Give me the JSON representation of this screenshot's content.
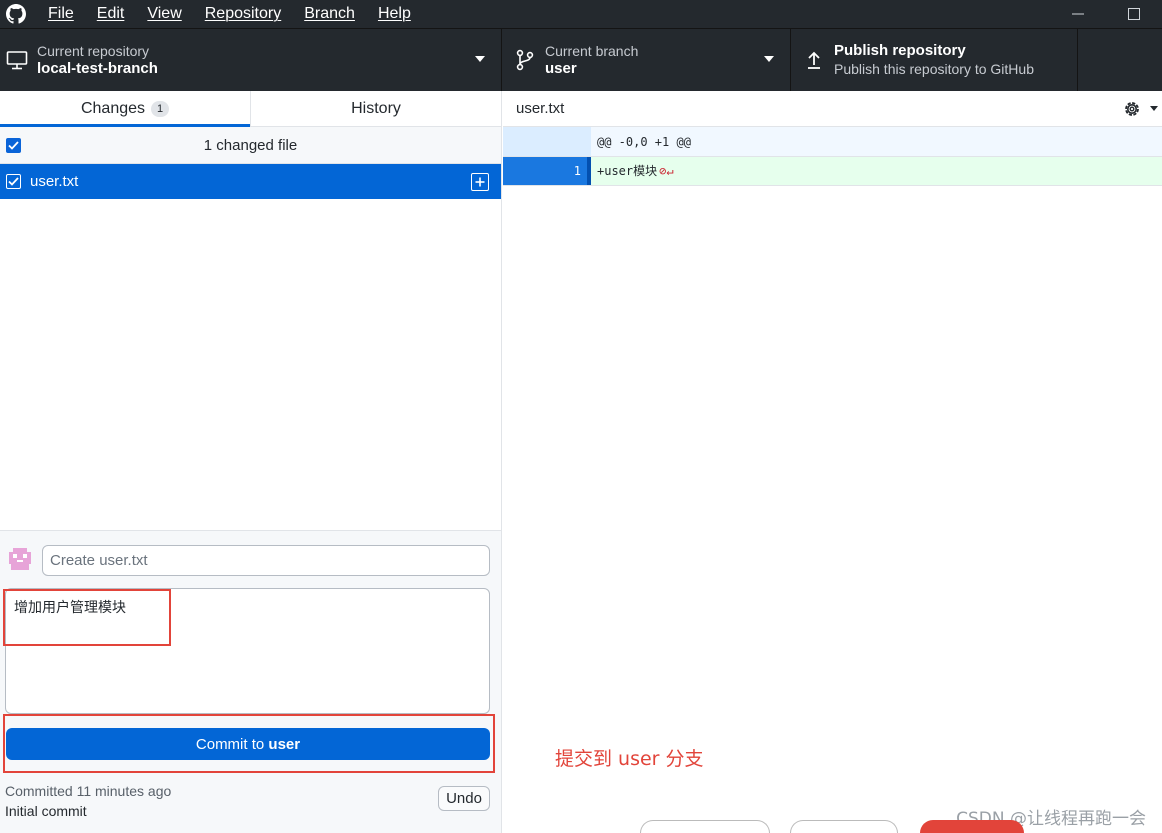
{
  "menu": {
    "items": [
      "File",
      "Edit",
      "View",
      "Repository",
      "Branch",
      "Help"
    ]
  },
  "toolbar": {
    "repo_label": "Current repository",
    "repo_value": "local-test-branch",
    "branch_label": "Current branch",
    "branch_value": "user",
    "publish_title": "Publish repository",
    "publish_subtitle": "Publish this repository to GitHub"
  },
  "tabs": {
    "changes_label": "Changes",
    "changes_count": "1",
    "history_label": "History"
  },
  "changes": {
    "header": "1 changed file",
    "files": [
      {
        "name": "user.txt",
        "status": "added"
      }
    ]
  },
  "commit": {
    "summary_placeholder": "Create user.txt",
    "description": "增加用户管理模块",
    "button_prefix": "Commit to ",
    "button_branch": "user",
    "last_commit_time": "Committed 11 minutes ago",
    "last_commit_message": "Initial commit",
    "undo_label": "Undo"
  },
  "diff": {
    "file": "user.txt",
    "hunk_header": "@@ -0,0 +1 @@",
    "lines": [
      {
        "new_line": "1",
        "text": "+user模块"
      }
    ]
  },
  "annotation": "提交到 user 分支",
  "watermark": "CSDN @让线程再跑一会",
  "colors": {
    "accent": "#0366d6",
    "annotation_red": "#e2443a",
    "titlebar": "#24292e",
    "added_bg": "#e6ffed"
  },
  "icons": {
    "app": "github-logo-icon",
    "repo": "computer-icon",
    "branch": "git-branch-icon",
    "publish": "upload-arrow-icon",
    "file_status": "file-added-icon",
    "settings": "gear-icon",
    "no_newline": "no-newline-icon"
  }
}
